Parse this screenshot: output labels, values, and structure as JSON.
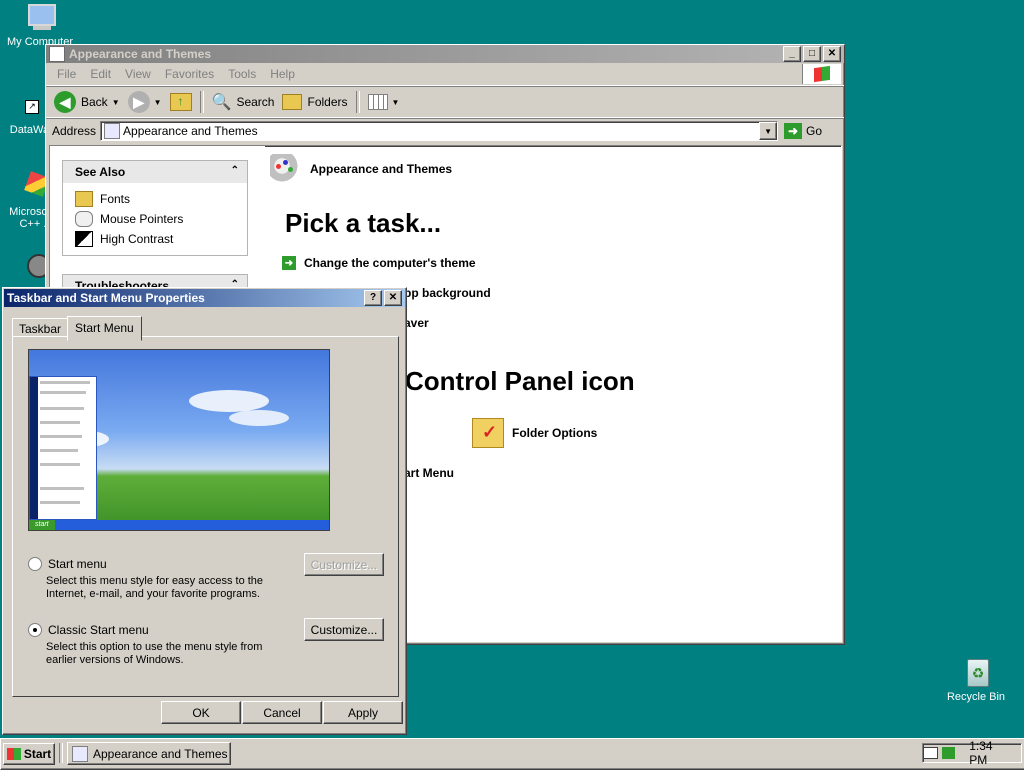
{
  "desktop": {
    "icons": [
      {
        "label": "My Computer"
      },
      {
        "label": "DataWa..."
      },
      {
        "label": "Microsoft..."
      },
      {
        "label": "C++ ..."
      },
      {
        "label": "Recycle Bin"
      }
    ]
  },
  "explorer": {
    "title": "Appearance and Themes",
    "menu": [
      "File",
      "Edit",
      "View",
      "Favorites",
      "Tools",
      "Help"
    ],
    "toolbar": {
      "back": "Back",
      "search": "Search",
      "folders": "Folders"
    },
    "address_label": "Address",
    "address_value": "Appearance and Themes",
    "go": "Go",
    "see_also": {
      "title": "See Also",
      "items": [
        "Fonts",
        "Mouse Pointers",
        "High Contrast"
      ]
    },
    "troubleshooters_title": "Troubleshooters",
    "header": "Appearance and Themes",
    "pick_task": "Pick a task...",
    "tasks": [
      "Change the computer's theme",
      "pp background",
      "aver"
    ],
    "pick_icon": "Control Panel icon",
    "folder_options": "Folder Options",
    "start_menu_partial": "art Menu"
  },
  "dialog": {
    "title": "Taskbar and Start Menu Properties",
    "help_btn": "?",
    "tabs": [
      "Taskbar",
      "Start Menu"
    ],
    "preview": {
      "start_label": "start"
    },
    "options": [
      {
        "label": "Start menu",
        "desc": "Select this menu style for easy access to the Internet, e-mail, and your favorite programs.",
        "selected": false,
        "button": "Customize...",
        "enabled": false
      },
      {
        "label": "Classic Start menu",
        "desc": "Select this option to use the menu style from earlier versions of Windows.",
        "selected": true,
        "button": "Customize...",
        "enabled": true
      }
    ],
    "buttons": {
      "ok": "OK",
      "cancel": "Cancel",
      "apply": "Apply"
    }
  },
  "taskbar": {
    "start": "Start",
    "task": "Appearance and Themes",
    "clock": "1:34 PM"
  }
}
